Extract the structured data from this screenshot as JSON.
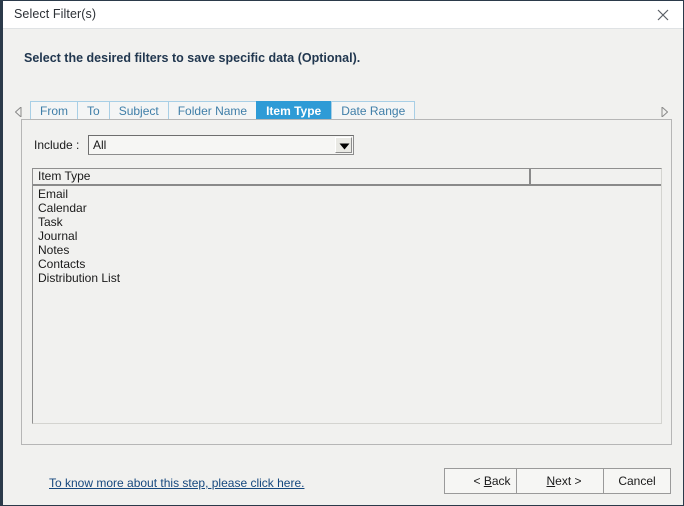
{
  "window": {
    "title": "Select Filter(s)",
    "close_icon": "close-icon",
    "accent_color": "#2e9bd6",
    "heading_color": "#21374f",
    "link_color": "#16487e"
  },
  "heading": {
    "text": "Select the desired filters to save specific data (Optional)."
  },
  "tabs": {
    "scroll_left_icon": "chevron-left-icon",
    "scroll_right_icon": "chevron-right-icon",
    "items": [
      {
        "label": "From",
        "active": false
      },
      {
        "label": "To",
        "active": false
      },
      {
        "label": "Subject",
        "active": false
      },
      {
        "label": "Folder Name",
        "active": false
      },
      {
        "label": "Item Type",
        "active": true
      },
      {
        "label": "Date Range",
        "active": false
      }
    ],
    "selected": "Item Type"
  },
  "panel": {
    "include": {
      "label": "Include :",
      "value": "All",
      "placeholder": "All",
      "arrow_icon": "chevron-down-icon",
      "options": [
        "All"
      ]
    },
    "list": {
      "columns": [
        "Item Type",
        ""
      ],
      "rows": [
        "Email",
        "Calendar",
        "Task",
        "Journal",
        "Notes",
        "Contacts",
        "Distribution List"
      ]
    }
  },
  "footer": {
    "help_link": "To know more about this step, please click here.",
    "buttons": {
      "back": {
        "prefix": "< ",
        "accel": "B",
        "rest": "ack"
      },
      "next": {
        "accel": "N",
        "rest": "ext",
        "suffix": " >"
      },
      "cancel": "Cancel"
    }
  }
}
